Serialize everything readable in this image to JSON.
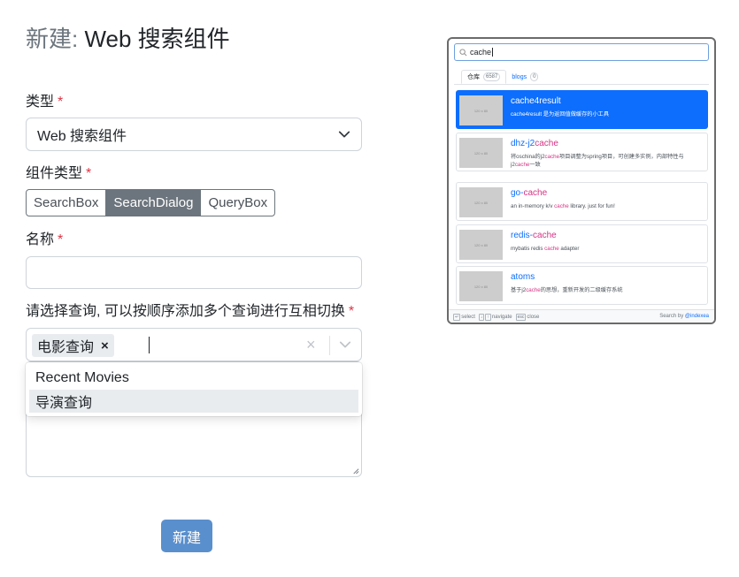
{
  "title": {
    "prefix": "新建:",
    "name": "Web 搜索组件"
  },
  "required_mark": "*",
  "fields": {
    "type_label": "类型",
    "type_value": "Web 搜索组件",
    "component_type_label": "组件类型",
    "component_types": [
      "SearchBox",
      "SearchDialog",
      "QueryBox"
    ],
    "component_type_selected": "SearchDialog",
    "name_label": "名称",
    "name_value": "",
    "query_label": "请选择查询, 可以按顺序添加多个查询进行互相切换",
    "query_selected": [
      {
        "label": "电影查询",
        "remove": "×"
      }
    ],
    "query_clear": "×",
    "query_options": [
      "Recent Movies",
      "导演查询"
    ],
    "query_option_highlighted": "导演查询"
  },
  "submit_label": "新建",
  "colors": {
    "primary": "#5a8fcd",
    "required": "#dc3545",
    "segment_active": "#6c757d",
    "preview_accent": "#0d6efd",
    "highlight": "#d63384"
  },
  "preview": {
    "search_value": "cache",
    "tabs": [
      {
        "label": "仓库",
        "count": "6587"
      },
      {
        "label": "blogs",
        "count": "0"
      }
    ],
    "thumb_text": "120 x 80",
    "results": [
      {
        "title": "cache4result",
        "title_hl": "",
        "desc": "cache4result 是为返回值做缓存的小工具",
        "desc_parts": [
          "cache4result 是为返回值做缓存的小工具",
          "",
          ""
        ]
      },
      {
        "title": "dhz-j2",
        "title_hl": "cache",
        "desc_parts": [
          "将oschina的j2",
          "cache",
          "项目调整为spring项目，可创建多实例，内部特性与j2"
        ],
        "desc_tail_hl": "cache",
        "desc_tail": "一致"
      },
      {
        "title": "go-",
        "title_hl": "cache",
        "desc_parts": [
          "an in-memory k/v ",
          "cache",
          " library. just for fun!"
        ]
      },
      {
        "title": "redis-",
        "title_hl": "cache",
        "desc_parts": [
          "mybatis redis ",
          "cache",
          " adapter"
        ]
      },
      {
        "title": "atoms",
        "title_hl": "",
        "desc_parts": [
          "基于j2",
          "cache",
          "的思想，重新开发的二级缓存系统"
        ]
      }
    ],
    "footer": {
      "select_key": "↵",
      "select": "select",
      "nav_keys": [
        "↓",
        "↑"
      ],
      "navigate": "navigate",
      "close_key": "esc",
      "close": "close",
      "brand_prefix": "Search by ",
      "brand": "@indexea"
    }
  }
}
